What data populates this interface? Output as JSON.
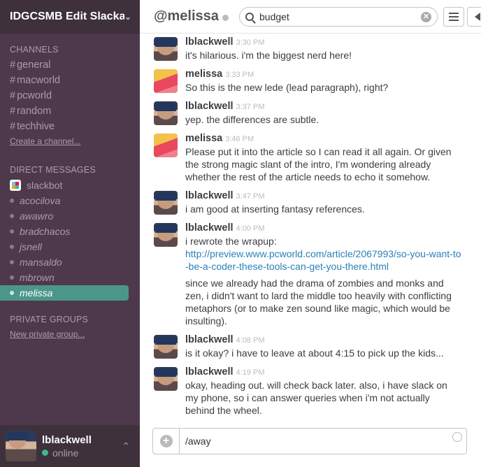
{
  "team": {
    "name": "IDGCSMB Edit Slackad..."
  },
  "sections": {
    "channels": "CHANNELS",
    "direct": "DIRECT MESSAGES",
    "private": "PRIVATE GROUPS"
  },
  "channels": [
    "general",
    "macworld",
    "pcworld",
    "random",
    "techhive"
  ],
  "channel_prefix": "#",
  "create_channel": "Create a channel...",
  "dms": [
    "slackbot",
    "acocilova",
    "awawro",
    "bradchacos",
    "jsnell",
    "mansaldo",
    "mbrown",
    "melissa"
  ],
  "new_private_group": "New private group...",
  "user": {
    "name": "lblackwell",
    "status": "online"
  },
  "header": {
    "title": "@melissa"
  },
  "search": {
    "query": "budget"
  },
  "messages": [
    {
      "who": "lblackwell",
      "time": "3:30 PM",
      "text": "it's hilarious. i'm the biggest nerd here!"
    },
    {
      "who": "melissa",
      "time": "3:33 PM",
      "text": "So this is the new lede (lead paragraph), right?"
    },
    {
      "who": "lblackwell",
      "time": "3:37 PM",
      "text": "yep. the differences are subtle."
    },
    {
      "who": "melissa",
      "time": "3:46 PM",
      "text": "Please put it into the article so I can read it all again. Or given the strong magic slant of the intro, I'm wondering already whether the rest of the article needs to echo it somehow."
    },
    {
      "who": "lblackwell",
      "time": "3:47 PM",
      "text": "i am good at inserting fantasy references."
    },
    {
      "who": "lblackwell",
      "time": "4:00 PM",
      "text": "i rewrote the wrapup:",
      "link": "http://preview.www.pcworld.com/article/2067993/so-you-want-to-be-a-coder-these-tools-can-get-you-there.html",
      "text2": "since we already had the drama of zombies and monks and zen, i didn't want to lard the middle too heavily with conflicting metaphors (or to make zen sound like magic, which would be insulting)."
    },
    {
      "who": "lblackwell",
      "time": "4:08 PM",
      "text": "is it okay? i have to leave at about 4:15 to pick up the kids..."
    },
    {
      "who": "lblackwell",
      "time": "4:19 PM",
      "text": "okay, heading out. will check back later.  also, i have slack on my phone, so i can answer queries when i'm not actually behind the wheel."
    }
  ],
  "composer": {
    "value": "/away"
  },
  "icons": {
    "search": "search-icon",
    "clear": "clear-icon",
    "list": "list-icon",
    "flag": "flag-icon",
    "plus": "plus-icon",
    "emoji": "emoji-icon"
  }
}
